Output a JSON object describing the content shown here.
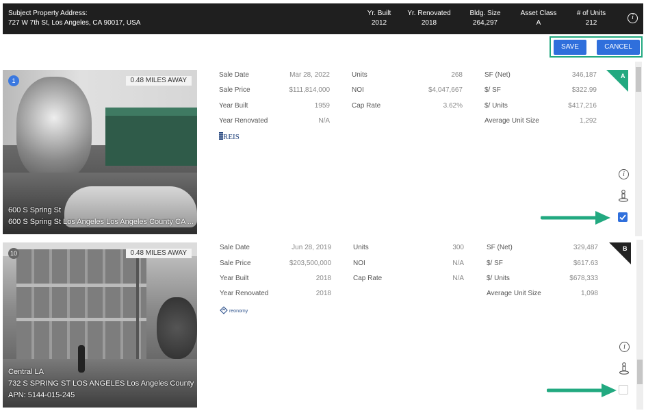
{
  "subject": {
    "address_label": "Subject Property Address:",
    "address": "727 W 7th St, Los Angeles, CA 90017, USA",
    "columns": [
      {
        "label": "Yr. Built",
        "value": "2012"
      },
      {
        "label": "Yr. Renovated",
        "value": "2018"
      },
      {
        "label": "Bldg. Size",
        "value": "264,297"
      },
      {
        "label": "Asset Class",
        "value": "A"
      },
      {
        "label": "# of Units",
        "value": "212"
      }
    ],
    "info_icon": "i"
  },
  "actions": {
    "save": "SAVE",
    "cancel": "CANCEL"
  },
  "properties": [
    {
      "index": "1",
      "distance": "0.48 MILES AWAY",
      "name": "600 S Spring St",
      "address": "600 S Spring St Los Angeles Los Angeles County CA ...",
      "apn": "",
      "class_badge": "A",
      "source_logo": "REIS",
      "checked": true,
      "col1": [
        {
          "label": "Sale Date",
          "value": "Mar 28, 2022"
        },
        {
          "label": "Sale Price",
          "value": "$111,814,000"
        },
        {
          "label": "Year Built",
          "value": "1959"
        },
        {
          "label": "Year Renovated",
          "value": "N/A"
        }
      ],
      "col2": [
        {
          "label": "Units",
          "value": "268"
        },
        {
          "label": "NOI",
          "value": "$4,047,667"
        },
        {
          "label": "Cap Rate",
          "value": "3.62%"
        }
      ],
      "col3": [
        {
          "label": "SF (Net)",
          "value": "346,187"
        },
        {
          "label": "$/ SF",
          "value": "$322.99"
        },
        {
          "label": "$/ Units",
          "value": "$417,216"
        },
        {
          "label": "Average Unit Size",
          "value": "1,292"
        }
      ]
    },
    {
      "index": "10",
      "distance": "0.48 MILES AWAY",
      "name": "Central LA",
      "address": "732 S SPRING ST LOS ANGELES Los Angeles County ...",
      "apn": "APN: 5144-015-245",
      "class_badge": "B",
      "source_logo": "reonomy",
      "checked": false,
      "col1": [
        {
          "label": "Sale Date",
          "value": "Jun 28, 2019"
        },
        {
          "label": "Sale Price",
          "value": "$203,500,000"
        },
        {
          "label": "Year Built",
          "value": "2018"
        },
        {
          "label": "Year Renovated",
          "value": "2018"
        }
      ],
      "col2": [
        {
          "label": "Units",
          "value": "300"
        },
        {
          "label": "NOI",
          "value": "N/A"
        },
        {
          "label": "Cap Rate",
          "value": "N/A"
        }
      ],
      "col3": [
        {
          "label": "SF (Net)",
          "value": "329,487"
        },
        {
          "label": "$/ SF",
          "value": "$617.63"
        },
        {
          "label": "$/ Units",
          "value": "$678,333"
        },
        {
          "label": "Average Unit Size",
          "value": "1,098"
        }
      ]
    }
  ],
  "colors": {
    "accent_green": "#22a980",
    "button_blue": "#2f6fdc",
    "header_bg": "#1f1f1f"
  },
  "icons": [
    "info-icon",
    "street-view-icon",
    "checkbox-icon",
    "arrow-icon"
  ]
}
